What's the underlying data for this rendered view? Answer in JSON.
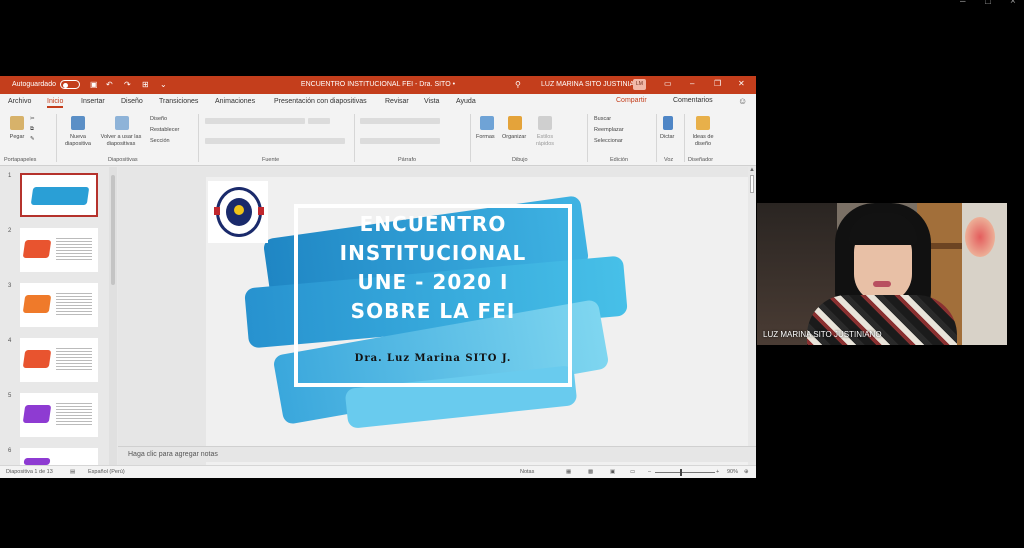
{
  "window": {
    "autosave_label": "Autoguardado",
    "doc_title": "ENCUENTRO INSTITUCIONAL FEI - Dra. SITO  •",
    "user_name": "LUZ MARINA SITO JUSTINIANO",
    "user_initials": "LM"
  },
  "menu": {
    "tabs": [
      "Archivo",
      "Inicio",
      "Insertar",
      "Diseño",
      "Transiciones",
      "Animaciones",
      "Presentación con diapositivas",
      "Revisar",
      "Vista",
      "Ayuda"
    ],
    "active_tab": "Inicio",
    "share": "Compartir",
    "comments": "Comentarios"
  },
  "ribbon": {
    "paste": "Pegar",
    "new_slide": "Nueva diapositiva",
    "reuse": "Volver a usar las diapositivas",
    "design": "Diseño",
    "reset": "Restablecer",
    "section": "Sección",
    "shapes": "Formas",
    "arrange": "Organizar",
    "quick_styles": "Estilos rápidos",
    "find": "Buscar",
    "replace": "Reemplazar",
    "select": "Seleccionar",
    "dictate": "Dictar",
    "design_ideas": "Ideas de diseño",
    "groups": [
      "Portapapeles",
      "Diapositivas",
      "Fuente",
      "Párrafo",
      "Dibujo",
      "Edición",
      "Voz",
      "Diseñador"
    ]
  },
  "slides": {
    "numbers": [
      "1",
      "2",
      "3",
      "4",
      "5",
      "6"
    ],
    "selected": "1"
  },
  "slide": {
    "title_lines": [
      "ENCUENTRO",
      "INSTITUCIONAL",
      "UNE - 2020 I",
      "SOBRE LA FEI"
    ],
    "author": "Dra. Luz Marina SITO J."
  },
  "notes_placeholder": "Haga clic para agregar notas",
  "status": {
    "slide_count": "Diapositiva 1 de 13",
    "language": "Español (Perú)",
    "notes": "Notas",
    "zoom": "90%"
  },
  "webcam": {
    "participant_name": "LUZ MARINA SITO JUSTINIANO"
  },
  "colors": {
    "accent": "#c43e1c",
    "slide_blue": "#2a9fd6"
  }
}
